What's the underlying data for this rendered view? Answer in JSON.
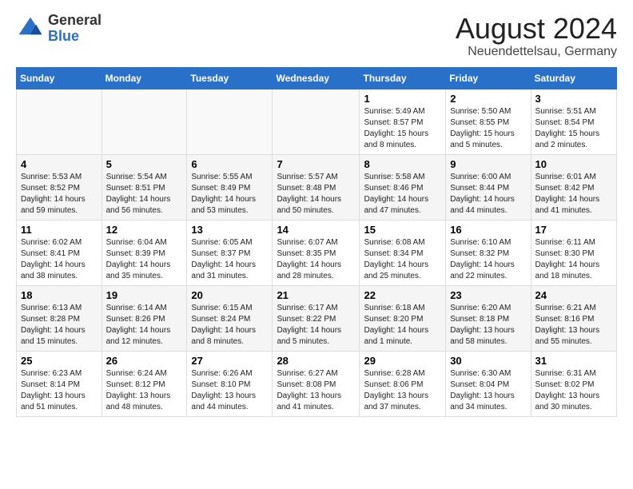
{
  "logo": {
    "general": "General",
    "blue": "Blue"
  },
  "title": "August 2024",
  "subtitle": "Neuendettelsau, Germany",
  "days_of_week": [
    "Sunday",
    "Monday",
    "Tuesday",
    "Wednesday",
    "Thursday",
    "Friday",
    "Saturday"
  ],
  "weeks": [
    [
      {
        "day": "",
        "info": ""
      },
      {
        "day": "",
        "info": ""
      },
      {
        "day": "",
        "info": ""
      },
      {
        "day": "",
        "info": ""
      },
      {
        "day": "1",
        "info": "Sunrise: 5:49 AM\nSunset: 8:57 PM\nDaylight: 15 hours\nand 8 minutes."
      },
      {
        "day": "2",
        "info": "Sunrise: 5:50 AM\nSunset: 8:55 PM\nDaylight: 15 hours\nand 5 minutes."
      },
      {
        "day": "3",
        "info": "Sunrise: 5:51 AM\nSunset: 8:54 PM\nDaylight: 15 hours\nand 2 minutes."
      }
    ],
    [
      {
        "day": "4",
        "info": "Sunrise: 5:53 AM\nSunset: 8:52 PM\nDaylight: 14 hours\nand 59 minutes."
      },
      {
        "day": "5",
        "info": "Sunrise: 5:54 AM\nSunset: 8:51 PM\nDaylight: 14 hours\nand 56 minutes."
      },
      {
        "day": "6",
        "info": "Sunrise: 5:55 AM\nSunset: 8:49 PM\nDaylight: 14 hours\nand 53 minutes."
      },
      {
        "day": "7",
        "info": "Sunrise: 5:57 AM\nSunset: 8:48 PM\nDaylight: 14 hours\nand 50 minutes."
      },
      {
        "day": "8",
        "info": "Sunrise: 5:58 AM\nSunset: 8:46 PM\nDaylight: 14 hours\nand 47 minutes."
      },
      {
        "day": "9",
        "info": "Sunrise: 6:00 AM\nSunset: 8:44 PM\nDaylight: 14 hours\nand 44 minutes."
      },
      {
        "day": "10",
        "info": "Sunrise: 6:01 AM\nSunset: 8:42 PM\nDaylight: 14 hours\nand 41 minutes."
      }
    ],
    [
      {
        "day": "11",
        "info": "Sunrise: 6:02 AM\nSunset: 8:41 PM\nDaylight: 14 hours\nand 38 minutes."
      },
      {
        "day": "12",
        "info": "Sunrise: 6:04 AM\nSunset: 8:39 PM\nDaylight: 14 hours\nand 35 minutes."
      },
      {
        "day": "13",
        "info": "Sunrise: 6:05 AM\nSunset: 8:37 PM\nDaylight: 14 hours\nand 31 minutes."
      },
      {
        "day": "14",
        "info": "Sunrise: 6:07 AM\nSunset: 8:35 PM\nDaylight: 14 hours\nand 28 minutes."
      },
      {
        "day": "15",
        "info": "Sunrise: 6:08 AM\nSunset: 8:34 PM\nDaylight: 14 hours\nand 25 minutes."
      },
      {
        "day": "16",
        "info": "Sunrise: 6:10 AM\nSunset: 8:32 PM\nDaylight: 14 hours\nand 22 minutes."
      },
      {
        "day": "17",
        "info": "Sunrise: 6:11 AM\nSunset: 8:30 PM\nDaylight: 14 hours\nand 18 minutes."
      }
    ],
    [
      {
        "day": "18",
        "info": "Sunrise: 6:13 AM\nSunset: 8:28 PM\nDaylight: 14 hours\nand 15 minutes."
      },
      {
        "day": "19",
        "info": "Sunrise: 6:14 AM\nSunset: 8:26 PM\nDaylight: 14 hours\nand 12 minutes."
      },
      {
        "day": "20",
        "info": "Sunrise: 6:15 AM\nSunset: 8:24 PM\nDaylight: 14 hours\nand 8 minutes."
      },
      {
        "day": "21",
        "info": "Sunrise: 6:17 AM\nSunset: 8:22 PM\nDaylight: 14 hours\nand 5 minutes."
      },
      {
        "day": "22",
        "info": "Sunrise: 6:18 AM\nSunset: 8:20 PM\nDaylight: 14 hours\nand 1 minute."
      },
      {
        "day": "23",
        "info": "Sunrise: 6:20 AM\nSunset: 8:18 PM\nDaylight: 13 hours\nand 58 minutes."
      },
      {
        "day": "24",
        "info": "Sunrise: 6:21 AM\nSunset: 8:16 PM\nDaylight: 13 hours\nand 55 minutes."
      }
    ],
    [
      {
        "day": "25",
        "info": "Sunrise: 6:23 AM\nSunset: 8:14 PM\nDaylight: 13 hours\nand 51 minutes."
      },
      {
        "day": "26",
        "info": "Sunrise: 6:24 AM\nSunset: 8:12 PM\nDaylight: 13 hours\nand 48 minutes."
      },
      {
        "day": "27",
        "info": "Sunrise: 6:26 AM\nSunset: 8:10 PM\nDaylight: 13 hours\nand 44 minutes."
      },
      {
        "day": "28",
        "info": "Sunrise: 6:27 AM\nSunset: 8:08 PM\nDaylight: 13 hours\nand 41 minutes."
      },
      {
        "day": "29",
        "info": "Sunrise: 6:28 AM\nSunset: 8:06 PM\nDaylight: 13 hours\nand 37 minutes."
      },
      {
        "day": "30",
        "info": "Sunrise: 6:30 AM\nSunset: 8:04 PM\nDaylight: 13 hours\nand 34 minutes."
      },
      {
        "day": "31",
        "info": "Sunrise: 6:31 AM\nSunset: 8:02 PM\nDaylight: 13 hours\nand 30 minutes."
      }
    ]
  ]
}
